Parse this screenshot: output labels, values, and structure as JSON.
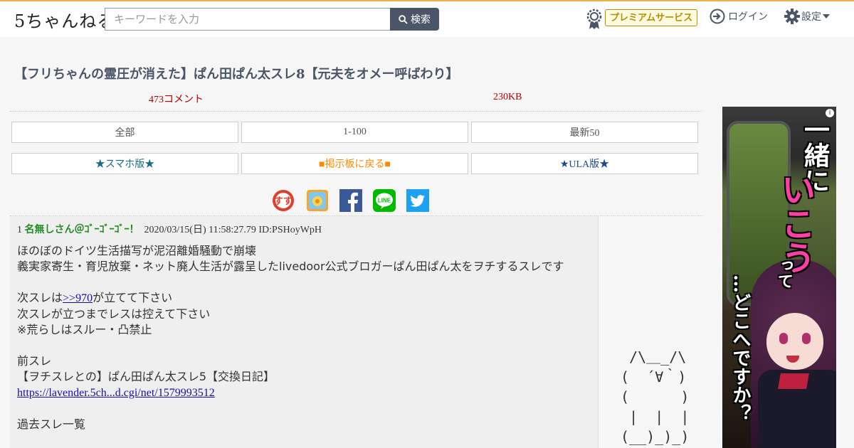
{
  "header": {
    "logo_text": "5ちゃんねる",
    "search_placeholder": "キーワードを入力",
    "search_button": "検索",
    "premium_label": "プレミアムサービス",
    "login_label": "ログイン",
    "settings_label": "設定"
  },
  "thread": {
    "title": "【フリちゃんの霊圧が消えた】ぱん田ぱん太スレ8【元夫をオメー呼ばわり】",
    "comments": "473コメント",
    "size": "230KB"
  },
  "nav": {
    "all": "全部",
    "range": "1-100",
    "latest": "最新50",
    "smartphone": "★スマホ版★",
    "back_to_board": "■掲示板に戻る■",
    "ula": "★ULA版★"
  },
  "share": {
    "icons": [
      "5ch-sns-icon",
      "bookmark-icon",
      "facebook-icon",
      "line-icon",
      "twitter-icon"
    ],
    "line_text": "LINE"
  },
  "post": {
    "number": "1",
    "name": "名無しさん＠ｺﾞｰｺﾞｰｺﾞｰ！",
    "datetime": "2020/03/15(日) 11:58:27.79",
    "id": "ID:PSHoyWpH",
    "line1": "ほのぼのドイツ生活描写が泥沼離婚騒動で崩壊",
    "line2": "義実家寄生・育児放棄・ネット廃人生活が露呈したlivedoor公式ブロガーぱん田ぱん太をヲチするスレです",
    "line3_prefix": "次スレは",
    "line3_link": ">>970",
    "line3_suffix": "が立てて下さい",
    "line4": "次スレが立つまでレスは控えて下さい",
    "line5": "※荒らしはスルー・凸禁止",
    "line6": "前スレ",
    "line7": "【ヲチスレとの】ぱん田ぱん太スレ5【交換日記】",
    "line8_link": "https://lavender.5ch...d.cgi/net/1579993512",
    "line9": "過去スレ一覧"
  },
  "ascii_art": "  /\\＿_/\\\n (  ´∀｀)\n (      )\n  |  |  |\n (__)_)_)",
  "ad": {
    "info": "i",
    "text1": "一緒に",
    "text2": "いこう",
    "text3": "って",
    "text4": "…どこへですか？"
  },
  "colors": {
    "title": "#4a5568",
    "red_meta": "#b30000",
    "post_name": "#228b22",
    "link": "#1a0dab",
    "header_accent": "#f0b04a"
  }
}
